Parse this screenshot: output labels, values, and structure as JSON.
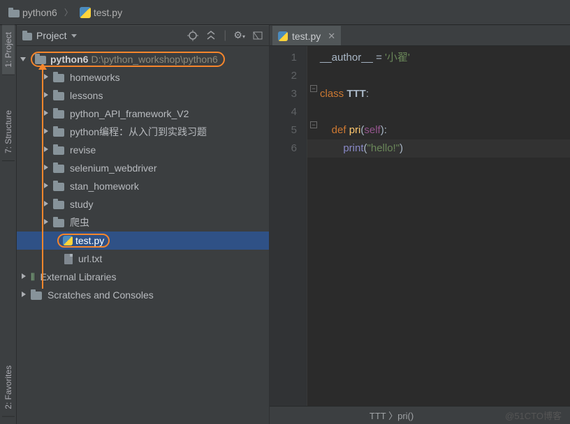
{
  "breadcrumb": {
    "root": "python6",
    "file": "test.py"
  },
  "project_panel": {
    "title": "Project",
    "root": {
      "name": "python6",
      "path": "D:\\python_workshop\\python6"
    },
    "folders": [
      "homeworks",
      "lessons",
      "python_API_framework_V2",
      "python编程：从入门到实践习题",
      "revise",
      "selenium_webdriver",
      "stan_homework",
      "study",
      "爬虫"
    ],
    "selected_file": "test.py",
    "other_file": "url.txt",
    "ext_libs": "External Libraries",
    "scratches": "Scratches and Consoles"
  },
  "rails": {
    "project": "1: Project",
    "structure": "7: Structure",
    "favorites": "2: Favorites"
  },
  "editor": {
    "tab": {
      "name": "test.py"
    },
    "lines": [
      "1",
      "2",
      "3",
      "4",
      "5",
      "6"
    ],
    "code": {
      "author_var": "__author__",
      "eq": " = ",
      "author_str": "'小翟'",
      "class_kw": "class ",
      "class_name": "TTT",
      "colon": ":",
      "def_kw": "def ",
      "fn": "pri",
      "lp": "(",
      "self": "self",
      "rp": ")",
      "print": "print",
      "str": "\"hello!\""
    },
    "bottom_crumb": "TTT 〉pri()"
  },
  "watermark": "@51CTO博客"
}
